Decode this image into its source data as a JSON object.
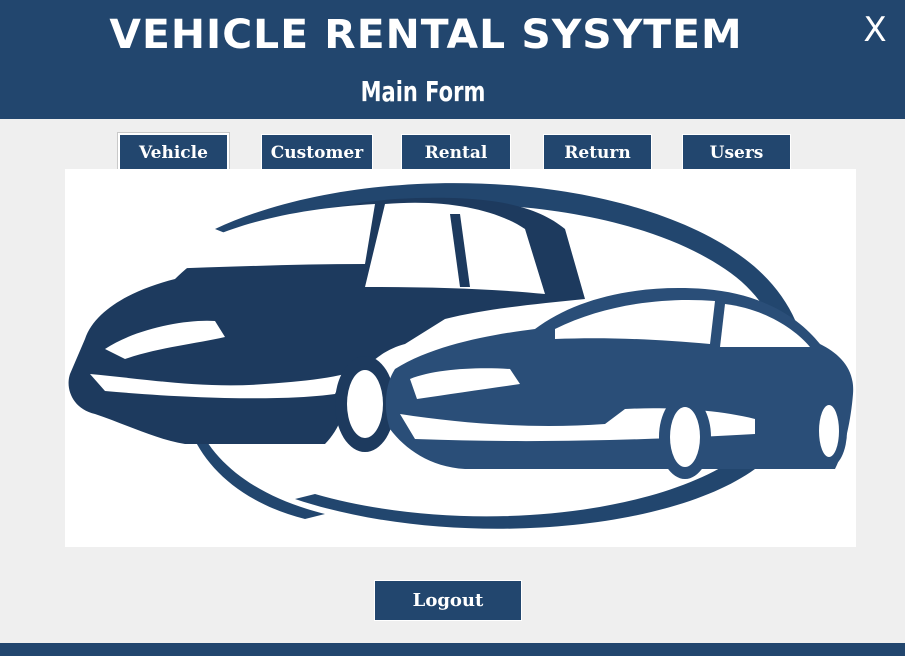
{
  "header": {
    "title": "VEHICLE RENTAL SYSYTEM",
    "subtitle": "Main Form",
    "close_label": "X"
  },
  "tabs": [
    {
      "label": "Vehicle"
    },
    {
      "label": "Customer"
    },
    {
      "label": "Rental"
    },
    {
      "label": "Return"
    },
    {
      "label": "Users"
    }
  ],
  "logout_label": "Logout",
  "colors": {
    "primary": "#22466e",
    "background": "#efefef",
    "panel": "#ffffff"
  },
  "logo": {
    "icon": "cars-logo-icon"
  }
}
